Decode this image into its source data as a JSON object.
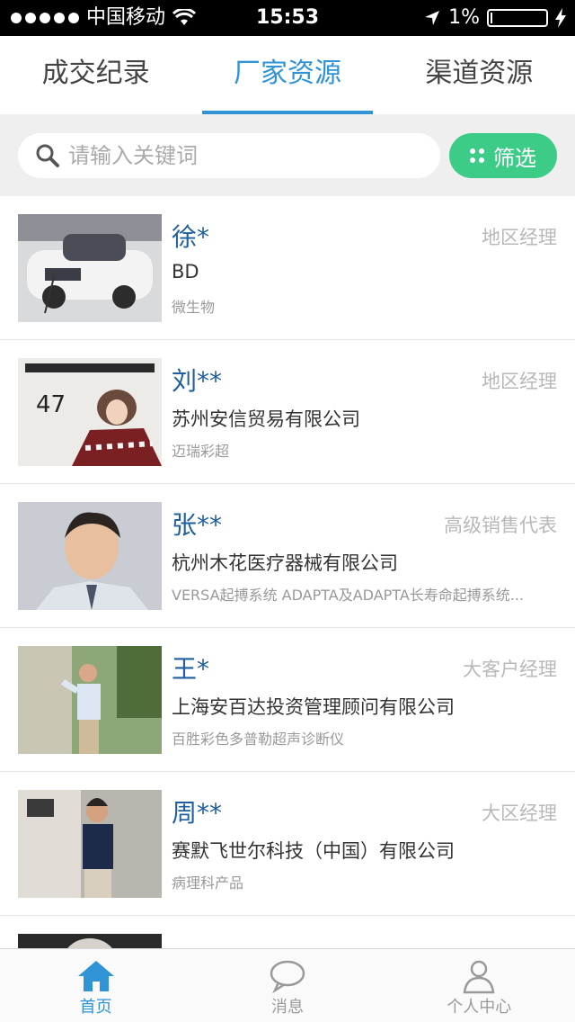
{
  "status": {
    "carrier": "中国移动",
    "time": "15:53",
    "battery_text": "1%",
    "battery_level": 0.01
  },
  "tabs": [
    {
      "label": "成交纪录"
    },
    {
      "label": "厂家资源"
    },
    {
      "label": "渠道资源"
    }
  ],
  "search": {
    "placeholder": "请输入关键词",
    "value": "",
    "filter_label": "筛选"
  },
  "items": [
    {
      "name": "徐*",
      "role": "地区经理",
      "company": "BD",
      "product": "微生物"
    },
    {
      "name": "刘**",
      "role": "地区经理",
      "company": "苏州安信贸易有限公司",
      "product": "迈瑞彩超"
    },
    {
      "name": "张**",
      "role": "高级销售代表",
      "company": "杭州木花医疗器械有限公司",
      "product": "VERSA起搏系统 ADAPTA及ADAPTA长寿命起搏系统..."
    },
    {
      "name": "王*",
      "role": "大客户经理",
      "company": "上海安百达投资管理顾问有限公司",
      "product": "百胜彩色多普勒超声诊断仪"
    },
    {
      "name": "周**",
      "role": "大区经理",
      "company": "赛默飞世尔科技（中国）有限公司",
      "product": "病理科产品"
    }
  ],
  "bottom_nav": [
    {
      "label": "首页"
    },
    {
      "label": "消息"
    },
    {
      "label": "个人中心"
    }
  ],
  "colors": {
    "accent": "#2f93d6",
    "filter_green": "#3ccc88"
  }
}
